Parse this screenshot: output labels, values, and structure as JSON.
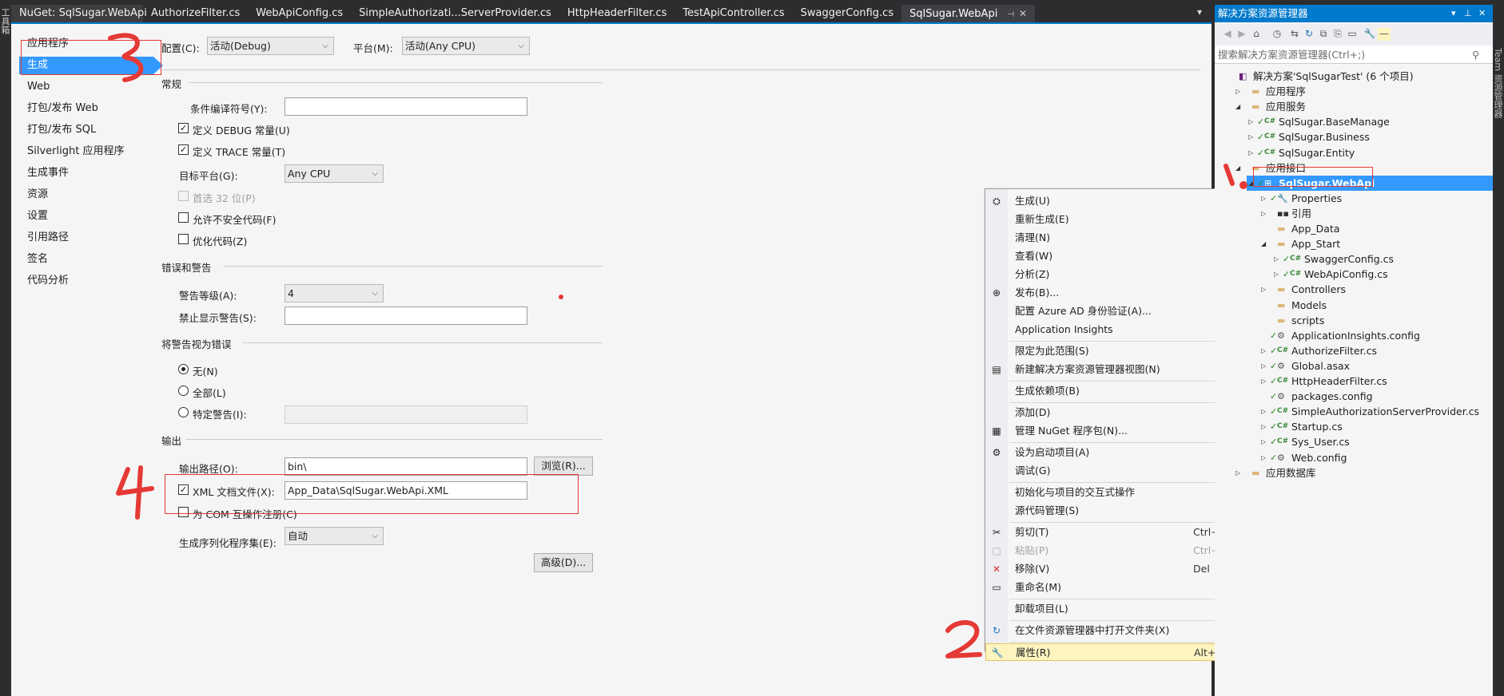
{
  "left_strip": {
    "text": "工具箱"
  },
  "tabs": [
    {
      "label": "NuGet: SqlSugar.WebApi"
    },
    {
      "label": "AuthorizeFilter.cs"
    },
    {
      "label": "WebApiConfig.cs"
    },
    {
      "label": "SimpleAuthorizati...ServerProvider.cs"
    },
    {
      "label": "HttpHeaderFilter.cs"
    },
    {
      "label": "TestApiController.cs"
    },
    {
      "label": "SwaggerConfig.cs"
    },
    {
      "label": "SqlSugar.WebApi",
      "active": true
    }
  ],
  "tab_icons": {
    "pin": "pin-icon",
    "close": "close-icon",
    "dropdown": "tab-dropdown-icon"
  },
  "props_nav": [
    {
      "label": "应用程序"
    },
    {
      "label": "生成",
      "active": true
    },
    {
      "label": "Web"
    },
    {
      "label": "打包/发布 Web"
    },
    {
      "label": "打包/发布 SQL"
    },
    {
      "label": "Silverlight 应用程序"
    },
    {
      "label": "生成事件"
    },
    {
      "label": "资源"
    },
    {
      "label": "设置"
    },
    {
      "label": "引用路径"
    },
    {
      "label": "签名"
    },
    {
      "label": "代码分析"
    }
  ],
  "build": {
    "config_label": "配置(C):",
    "config_value": "活动(Debug)",
    "platform_label": "平台(M):",
    "platform_value": "活动(Any CPU)",
    "general": {
      "title": "常规",
      "conditional_symbols_label": "条件编译符号(Y):",
      "conditional_symbols_value": "",
      "define_debug": "定义 DEBUG 常量(U)",
      "define_debug_checked": true,
      "define_trace": "定义 TRACE 常量(T)",
      "define_trace_checked": true,
      "target_platform_label": "目标平台(G):",
      "target_platform_value": "Any CPU",
      "prefer32": "首选 32 位(P)",
      "prefer32_checked": false,
      "allow_unsafe": "允许不安全代码(F)",
      "allow_unsafe_checked": false,
      "optimize": "优化代码(Z)",
      "optimize_checked": false
    },
    "errors": {
      "title": "错误和警告",
      "warning_level_label": "警告等级(A):",
      "warning_level_value": "4",
      "suppress_label": "禁止显示警告(S):",
      "suppress_value": ""
    },
    "treat_warnings": {
      "title": "将警告视为错误",
      "none": "无(N)",
      "all": "全部(L)",
      "specific": "特定警告(I):",
      "selected": "none",
      "specific_value": ""
    },
    "output": {
      "title": "输出",
      "path_label": "输出路径(O):",
      "path_value": "bin\\",
      "browse": "浏览(R)...",
      "xml_doc_label": "XML 文档文件(X):",
      "xml_doc_checked": true,
      "xml_doc_value": "App_Data\\SqlSugar.WebApi.XML",
      "com_interop": "为 COM 互操作注册(C)",
      "com_interop_checked": false,
      "serialization_label": "生成序列化程序集(E):",
      "serialization_value": "自动",
      "advanced": "高级(D)..."
    }
  },
  "context_menu": [
    {
      "icon": "build-icon",
      "label": "生成(U)"
    },
    {
      "label": "重新生成(E)"
    },
    {
      "label": "清理(N)"
    },
    {
      "label": "查看(W)",
      "submenu": true
    },
    {
      "label": "分析(Z)",
      "submenu": true
    },
    {
      "icon": "publish-icon",
      "label": "发布(B)..."
    },
    {
      "label": "配置 Azure AD 身份验证(A)..."
    },
    {
      "label": "Application Insights",
      "submenu": true
    },
    {
      "sep": true
    },
    {
      "label": "限定为此范围(S)"
    },
    {
      "icon": "new-view-icon",
      "label": "新建解决方案资源管理器视图(N)"
    },
    {
      "sep": true
    },
    {
      "label": "生成依赖项(B)",
      "submenu": true
    },
    {
      "sep": true
    },
    {
      "label": "添加(D)",
      "submenu": true
    },
    {
      "icon": "nuget-icon",
      "label": "管理 NuGet 程序包(N)..."
    },
    {
      "sep": true
    },
    {
      "icon": "gear-icon",
      "label": "设为启动项目(A)"
    },
    {
      "label": "调试(G)",
      "submenu": true
    },
    {
      "sep": true
    },
    {
      "label": "初始化与项目的交互式操作"
    },
    {
      "label": "源代码管理(S)",
      "submenu": true
    },
    {
      "sep": true
    },
    {
      "icon": "cut-icon",
      "label": "剪切(T)",
      "shortcut": "Ctrl+X"
    },
    {
      "icon": "paste-icon",
      "label": "粘贴(P)",
      "shortcut": "Ctrl+V",
      "disabled": true
    },
    {
      "icon": "remove-icon",
      "label": "移除(V)",
      "shortcut": "Del"
    },
    {
      "icon": "rename-icon",
      "label": "重命名(M)"
    },
    {
      "sep": true
    },
    {
      "label": "卸载项目(L)"
    },
    {
      "sep": true
    },
    {
      "icon": "refresh-folder-icon",
      "label": "在文件资源管理器中打开文件夹(X)"
    },
    {
      "sep": true
    },
    {
      "icon": "wrench-icon",
      "label": "属性(R)",
      "shortcut": "Alt+Enter",
      "hover": true
    }
  ],
  "solution_explorer": {
    "title": "解决方案资源管理器",
    "search_placeholder": "搜索解决方案资源管理器(Ctrl+;)",
    "tree": [
      {
        "depth": 0,
        "label": "解决方案'SqlSugarTest' (6 个项目)",
        "type": "solution",
        "exp": ""
      },
      {
        "depth": 1,
        "label": "应用程序",
        "type": "folder",
        "exp": "▷"
      },
      {
        "depth": 1,
        "label": "应用服务",
        "type": "folder",
        "exp": "◢"
      },
      {
        "depth": 2,
        "label": "SqlSugar.BaseManage",
        "type": "csproj",
        "exp": "▷"
      },
      {
        "depth": 2,
        "label": "SqlSugar.Business",
        "type": "csproj",
        "exp": "▷"
      },
      {
        "depth": 2,
        "label": "SqlSugar.Entity",
        "type": "csproj",
        "exp": "▷"
      },
      {
        "depth": 1,
        "label": "应用接口",
        "type": "folder",
        "exp": "◢"
      },
      {
        "depth": 2,
        "label": "SqlSugar.WebApi",
        "type": "webproj",
        "exp": "◢",
        "selected": true
      },
      {
        "depth": 3,
        "label": "Properties",
        "type": "props",
        "exp": "▷"
      },
      {
        "depth": 3,
        "label": "引用",
        "type": "refs",
        "exp": "▷"
      },
      {
        "depth": 3,
        "label": "App_Data",
        "type": "folder",
        "exp": ""
      },
      {
        "depth": 3,
        "label": "App_Start",
        "type": "folder",
        "exp": "◢"
      },
      {
        "depth": 4,
        "label": "SwaggerConfig.cs",
        "type": "cs",
        "exp": "▷"
      },
      {
        "depth": 4,
        "label": "WebApiConfig.cs",
        "type": "cs",
        "exp": "▷"
      },
      {
        "depth": 3,
        "label": "Controllers",
        "type": "folder",
        "exp": "▷"
      },
      {
        "depth": 3,
        "label": "Models",
        "type": "folder",
        "exp": ""
      },
      {
        "depth": 3,
        "label": "scripts",
        "type": "folder",
        "exp": ""
      },
      {
        "depth": 3,
        "label": "ApplicationInsights.config",
        "type": "config",
        "exp": ""
      },
      {
        "depth": 3,
        "label": "AuthorizeFilter.cs",
        "type": "cs",
        "exp": "▷"
      },
      {
        "depth": 3,
        "label": "Global.asax",
        "type": "config",
        "exp": "▷"
      },
      {
        "depth": 3,
        "label": "HttpHeaderFilter.cs",
        "type": "cs",
        "exp": "▷"
      },
      {
        "depth": 3,
        "label": "packages.config",
        "type": "config",
        "exp": ""
      },
      {
        "depth": 3,
        "label": "SimpleAuthorizationServerProvider.cs",
        "type": "cs",
        "exp": "▷"
      },
      {
        "depth": 3,
        "label": "Startup.cs",
        "type": "cs",
        "exp": "▷"
      },
      {
        "depth": 3,
        "label": "Sys_User.cs",
        "type": "cs",
        "exp": "▷"
      },
      {
        "depth": 3,
        "label": "Web.config",
        "type": "config",
        "exp": "▷"
      },
      {
        "depth": 1,
        "label": "应用数据库",
        "type": "folder",
        "exp": "▷"
      }
    ]
  },
  "right_strip": {
    "text": "Team 资源管理器"
  },
  "annotations": {
    "a1": "1.",
    "a2": "2",
    "a3": "3",
    "a4": "4"
  },
  "colors": {
    "accent": "#007acc",
    "selection": "#3399ff",
    "annotation": "#e53935"
  }
}
